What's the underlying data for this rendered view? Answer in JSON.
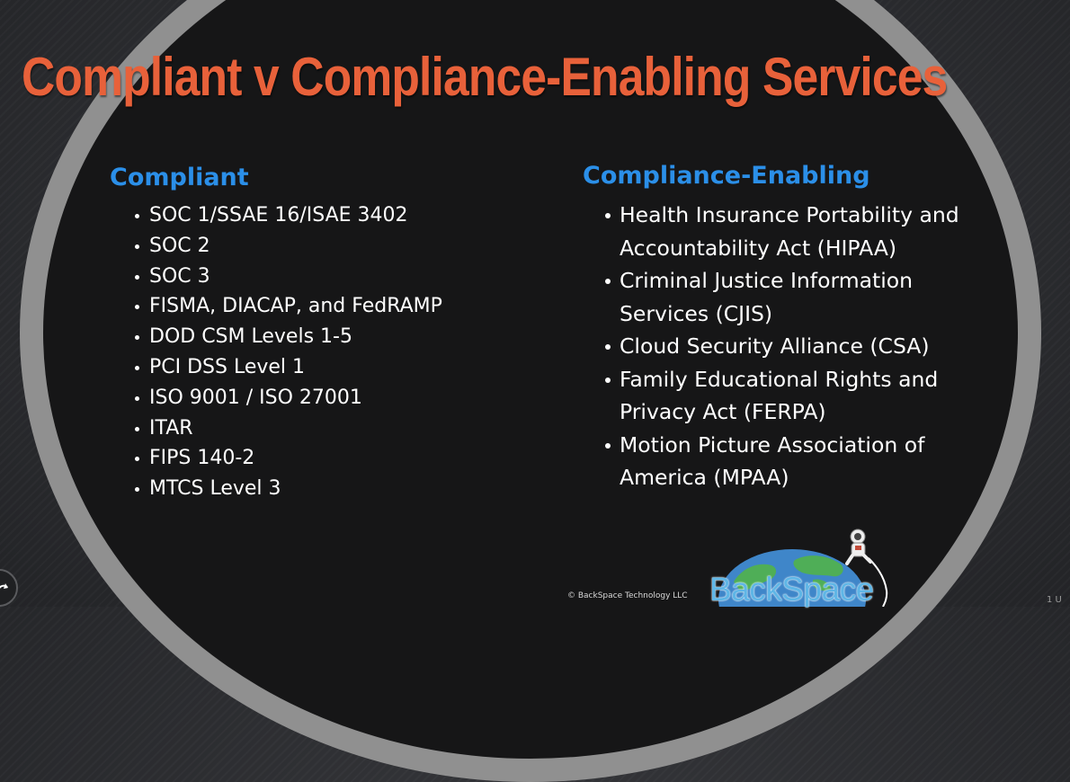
{
  "slide": {
    "title": "Compliant v Compliance-Enabling Services",
    "left_column": {
      "heading": "Compliant",
      "items": [
        "SOC 1/SSAE 16/ISAE 3402",
        "SOC 2",
        "SOC 3",
        "FISMA, DIACAP, and FedRAMP",
        "DOD CSM Levels 1-5",
        "PCI DSS Level 1",
        "ISO 9001 / ISO 27001",
        "ITAR",
        "FIPS 140-2",
        "MTCS Level 3"
      ]
    },
    "right_column": {
      "heading": "Compliance-Enabling",
      "items": [
        "Health Insurance Portability and Accountability Act (HIPAA)",
        "Criminal Justice Information Services (CJIS)",
        "Cloud Security Alliance (CSA)",
        "Family Educational Rights and Privacy Act (FERPA)",
        "Motion Picture Association of America (MPAA)"
      ]
    },
    "footer": {
      "copyright": "© BackSpace Technology LLC",
      "logo_text": "BackSpace"
    }
  },
  "player": {
    "corner_text": "1 U"
  },
  "colors": {
    "title": "#e8613a",
    "heading": "#2b8fe8",
    "text": "#ffffff",
    "ring": "#909090",
    "disc": "#161617",
    "background": "#2b2c2e"
  }
}
